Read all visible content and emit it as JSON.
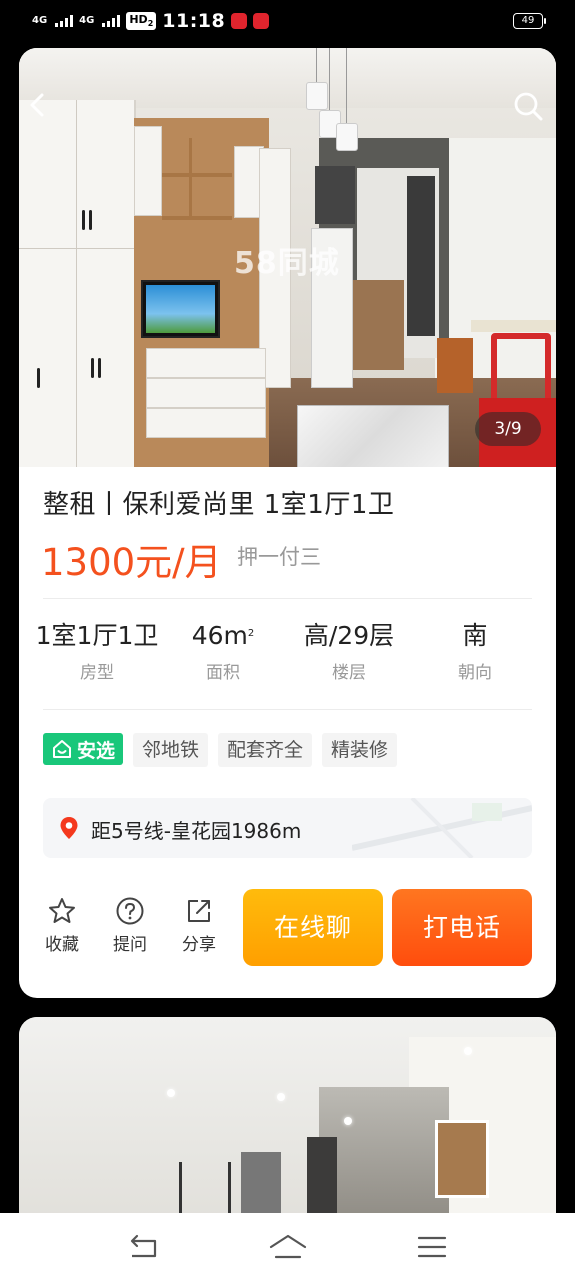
{
  "status_bar": {
    "signal1": "4G",
    "signal2": "4G",
    "hd": "HD",
    "hd_sub": "2",
    "time": "11:18",
    "battery": "49"
  },
  "listing": {
    "photo_counter": "3/9",
    "watermark": "58同城",
    "title": "整租丨保利爱尚里 1室1厅1卫",
    "price": "1300元/月",
    "payment": "押一付三",
    "specs": [
      {
        "value": "1室1厅1卫",
        "label": "房型"
      },
      {
        "value": "46m",
        "sup": "2",
        "label": "面积"
      },
      {
        "value": "高/29层",
        "label": "楼层"
      },
      {
        "value": "南",
        "label": "朝向"
      }
    ],
    "badge": "安选",
    "tags": [
      "邻地铁",
      "配套齐全",
      "精装修"
    ],
    "location": "距5号线-皇花园1986m",
    "actions": {
      "favorite": "收藏",
      "ask": "提问",
      "share": "分享",
      "chat": "在线聊",
      "call": "打电话"
    }
  },
  "colors": {
    "price": "#f4511e",
    "anxuan": "#19c77a",
    "chat_button": "#ffb000",
    "call_button": "#ff5a12"
  }
}
